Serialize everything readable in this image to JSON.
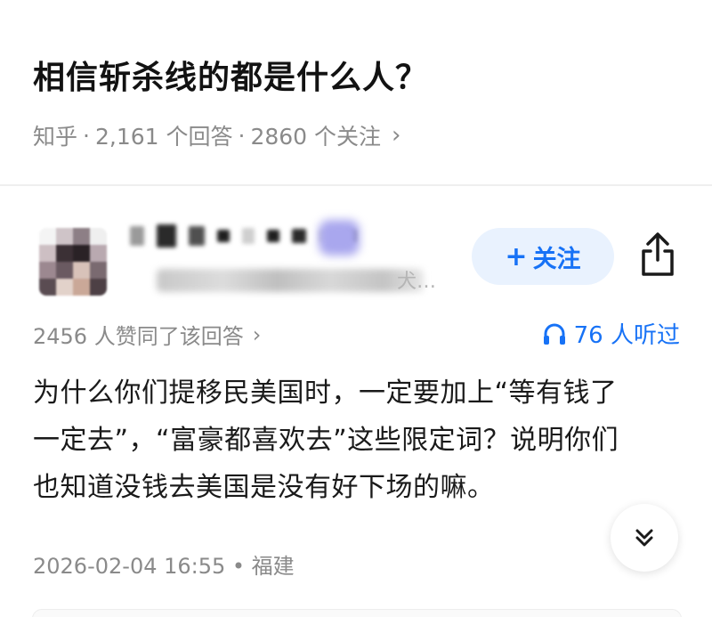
{
  "question": {
    "title": "相信斩杀线的都是什么人？",
    "source": "知乎",
    "answer_count": "2,161 个回答",
    "follow_count": "2860 个关注",
    "separator": "·",
    "chevron": "›"
  },
  "author": {
    "follow_label": "关注",
    "plus": "+",
    "bio_ellipsis": "犬…"
  },
  "answer": {
    "upvote_text": "2456 人赞同了该回答",
    "chevron": "›",
    "listen_text": "76 人听过",
    "lines": [
      "为什么你们提移民美国时，一定要加上“等有钱了",
      "一定去”，“富豪都喜欢去”这些限定词？说明你们",
      "也知道没钱去美国是没有好下场的嘛。"
    ],
    "timestamp": "2026-02-04 16:55 • 福建"
  },
  "colors": {
    "accent": "#1772f6",
    "follow_bg": "#e9f2fe",
    "muted_text": "#8a8a8a",
    "title_text": "#121212"
  },
  "icons": {
    "share": "share-icon",
    "headphones": "headphones-icon",
    "collapse": "chevron-double-down-icon"
  }
}
